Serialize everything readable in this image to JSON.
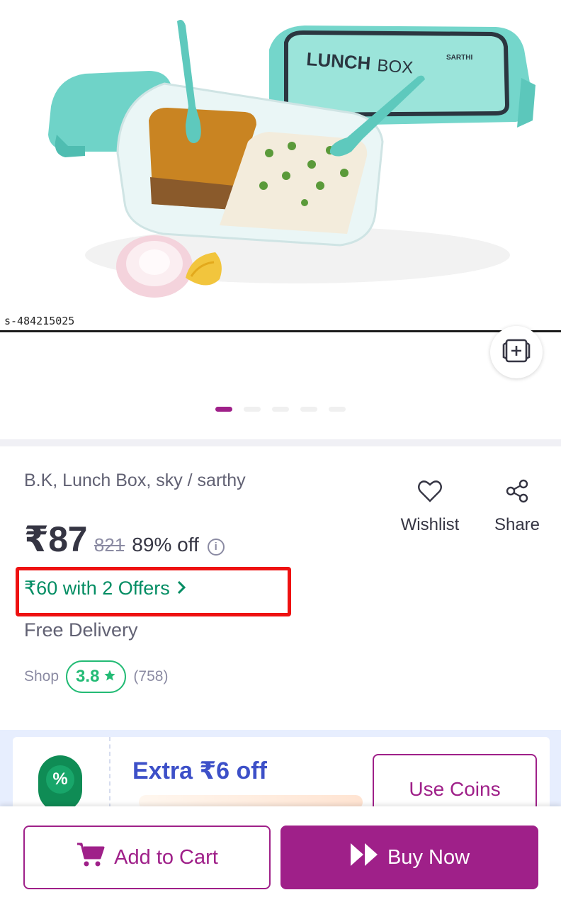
{
  "gallery": {
    "image_code": "s-484215025",
    "image_text": "LUNCH BOX",
    "image_brand": "SARTHI",
    "dot_count": 5,
    "active_dot": 0
  },
  "product": {
    "title": "B.K, Lunch Box, sky / sarthy",
    "price": "₹87",
    "mrp": "821",
    "discount": "89% off",
    "info_icon": "i",
    "offers_text": "₹60 with 2 Offers",
    "delivery": "Free Delivery",
    "shop_label": "Shop",
    "shop_rating": "3.8",
    "rating_count": "(758)"
  },
  "actions": {
    "wishlist_label": "Wishlist",
    "share_label": "Share"
  },
  "coins": {
    "extra_off": "Extra ₹6 off",
    "badge_symbol": "%",
    "use_coins_label": "Use Coins"
  },
  "bottom_bar": {
    "add_to_cart_label": "Add to Cart",
    "buy_now_label": "Buy Now"
  },
  "colors": {
    "brand": "#9f2089",
    "offer_green": "#038d63",
    "rating_green": "#23bb75",
    "highlight_red": "#ee1111",
    "coins_blue": "#3d50c8"
  },
  "icons": [
    "similar-products-icon",
    "heart-icon",
    "share-icon",
    "info-icon",
    "chevron-right-icon",
    "star-icon",
    "cart-icon",
    "fast-forward-icon",
    "percent-icon"
  ]
}
